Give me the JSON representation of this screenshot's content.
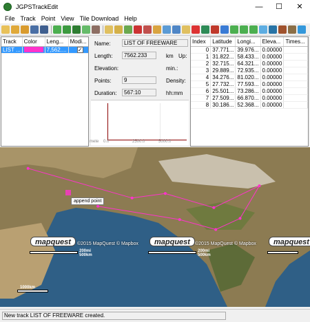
{
  "window": {
    "title": "JGPSTrackEdit",
    "minimize": "—",
    "maximize": "☐",
    "close": "✕"
  },
  "menu": [
    "File",
    "Track",
    "Point",
    "View",
    "Tile Download",
    "Help"
  ],
  "track_table": {
    "headers": [
      "Track",
      "Color",
      "Leng...",
      "Modi..."
    ],
    "rows": [
      {
        "track": "LIST ...",
        "color": "#ff33cc",
        "length": "7,562....",
        "modified": true
      }
    ]
  },
  "details": {
    "name_label": "Name:",
    "name_value": "LIST OF FREEWARE",
    "length_label": "Length:",
    "length_value": "7562.233",
    "length_unit": "km",
    "up_label": "Up:",
    "elevation_label": "Elevation:",
    "elevation_unit": "min.:",
    "points_label": "Points:",
    "points_value": "9",
    "density_label": "Density:",
    "duration_label": "Duration:",
    "duration_value": "567:10",
    "duration_unit": "hh:mm",
    "chart_ticks": [
      "0.0",
      "2500.0",
      "5000.0"
    ],
    "chart_left_label": "mete"
  },
  "points_table": {
    "headers": [
      "Index",
      "Latitude",
      "Longi...",
      "Eleva...",
      "Times..."
    ],
    "rows": [
      [
        "0",
        "37.771...",
        "39.976...",
        "0.00000",
        ""
      ],
      [
        "1",
        "31.822...",
        "58.433...",
        "0.00000",
        ""
      ],
      [
        "2",
        "32.715...",
        "64.321...",
        "0.00000",
        ""
      ],
      [
        "3",
        "29.889...",
        "72.935...",
        "0.00000",
        ""
      ],
      [
        "4",
        "34.276...",
        "81.020...",
        "0.00000",
        ""
      ],
      [
        "5",
        "27.732...",
        "77.593...",
        "0.00000",
        ""
      ],
      [
        "6",
        "25.501...",
        "73.286...",
        "0.00000",
        ""
      ],
      [
        "7",
        "27.509...",
        "66.870...",
        "0.00000",
        ""
      ],
      [
        "8",
        "30.186...",
        "52.368...",
        "0.00000",
        ""
      ]
    ]
  },
  "map": {
    "tooltip": "append point",
    "logo_text": "mapquest",
    "copyright": "©2015 MapQuest © Mapbox",
    "scale_top": "200mi",
    "scale_bottom": "500km",
    "scale_small": "1000km",
    "track_color": "#ff33cc"
  },
  "status": {
    "text": "New track LIST OF FREEWARE created."
  }
}
